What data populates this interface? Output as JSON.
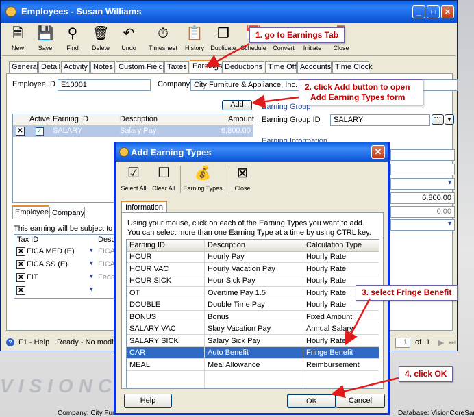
{
  "main_window": {
    "title": "Employees - Susan Williams",
    "toolbar": [
      {
        "label": "New",
        "icon": "new-document-icon"
      },
      {
        "label": "Save",
        "icon": "floppy-disk-icon"
      },
      {
        "label": "Find",
        "icon": "binoculars-icon"
      },
      {
        "label": "Delete",
        "icon": "trash-can-icon"
      },
      {
        "label": "Undo",
        "icon": "undo-arrow-icon"
      },
      {
        "label": "Timesheet",
        "icon": "timesheet-icon"
      },
      {
        "label": "History",
        "icon": "history-icon"
      },
      {
        "label": "Duplicate",
        "icon": "duplicate-icon"
      },
      {
        "label": "Schedule",
        "icon": "schedule-icon"
      },
      {
        "label": "Convert",
        "icon": "convert-icon"
      },
      {
        "label": "Initiate",
        "icon": "initiate-icon"
      },
      {
        "label": "Close",
        "icon": "close-door-icon"
      }
    ],
    "tabs": [
      "General",
      "Detail",
      "Activity",
      "Notes",
      "Custom Fields",
      "Taxes",
      "Earnings",
      "Deductions",
      "Time Off",
      "Accounts",
      "Time Clock"
    ],
    "active_tab": "Earnings",
    "employee_id_label": "Employee ID",
    "employee_id_value": "E10001",
    "company_label": "Company",
    "company_value": "City Furniture & Appliance, Inc.",
    "add_button": "Add",
    "earnings_grid": {
      "headers": [
        "Active",
        "Earning ID",
        "Description",
        "Amount"
      ],
      "rows": [
        {
          "earning_id": "SALARY",
          "description": "Salary Pay",
          "amount": "6,800.00"
        }
      ]
    },
    "earning_group_section": "Earning Group",
    "earning_group_id_label": "Earning Group ID",
    "earning_group_id_value": "SALARY",
    "earning_info_section": "Earning Information",
    "right_amount": "6,800.00",
    "right_zero": "0.00",
    "sub_tabs": [
      "Employee",
      "Company"
    ],
    "subject_text": "This earning will be subject to the",
    "tax_grid": {
      "headers": [
        "Tax ID",
        "Descr"
      ],
      "rows": [
        {
          "tax_id": "FICA MED (E)",
          "descr": "FICA M"
        },
        {
          "tax_id": "FICA SS (E)",
          "descr": "FICA S"
        },
        {
          "tax_id": "FIT",
          "descr": "Feder"
        },
        {
          "tax_id": "",
          "descr": ""
        }
      ]
    },
    "status": {
      "help": "F1 - Help",
      "ready": "Ready - No modifica",
      "page": "1",
      "of": "of",
      "total": "1"
    },
    "bottom_company": "Company: City Furn",
    "bottom_database": "Database: VisionCoreSar",
    "watermark": "VISIONCORE"
  },
  "dialog": {
    "title": "Add Earning Types",
    "toolbar": [
      {
        "label": "Select All",
        "icon": "select-all-icon"
      },
      {
        "label": "Clear All",
        "icon": "clear-all-icon"
      },
      {
        "label": "Earning Types",
        "icon": "earning-types-icon"
      },
      {
        "label": "Close",
        "icon": "close-icon"
      }
    ],
    "tab": "Information",
    "instruction_1": "Using your mouse, click on each of the Earning Types you want to add.",
    "instruction_2": "You can select more than one Earning Type at a time by using CTRL key.",
    "grid_headers": [
      "Earning ID",
      "Description",
      "Calculation Type"
    ],
    "rows": [
      {
        "id": "HOUR",
        "desc": "Hourly Pay",
        "calc": "Hourly Rate"
      },
      {
        "id": "HOUR VAC",
        "desc": "Hourly Vacation Pay",
        "calc": "Hourly Rate"
      },
      {
        "id": "HOUR SICK",
        "desc": "Hour Sick Pay",
        "calc": "Hourly Rate"
      },
      {
        "id": "OT",
        "desc": "Overtime Pay 1.5",
        "calc": "Hourly Rate"
      },
      {
        "id": "DOUBLE",
        "desc": "Double Time Pay",
        "calc": "Hourly Rate"
      },
      {
        "id": "BONUS",
        "desc": "Bonus",
        "calc": "Fixed Amount"
      },
      {
        "id": "SALARY VAC",
        "desc": "Slary Vacation Pay",
        "calc": "Annual Salary"
      },
      {
        "id": "SALARY SICK",
        "desc": "Salary Sick Pay",
        "calc": "Hourly Rate"
      },
      {
        "id": "CAR",
        "desc": "Auto Benefit",
        "calc": "Fringe Benefit"
      },
      {
        "id": "MEAL",
        "desc": "Meal Allowance",
        "calc": "Reimbursement"
      }
    ],
    "selected_row": 8,
    "help_button": "Help",
    "ok_button": "OK",
    "cancel_button": "Cancel"
  },
  "annotations": {
    "step1": "1.  go to Earnings Tab",
    "step2_line1": "2.  click Add button to open",
    "step2_line2": "Add Earning Types form",
    "step3": "3.  select Fringe Benefit",
    "step4": "4.  click OK"
  },
  "colors": {
    "title_blue": "#0a5ee4",
    "selection_blue": "#316ac5",
    "annotation_red": "#c00000",
    "arrow_red": "#e01b1b"
  }
}
